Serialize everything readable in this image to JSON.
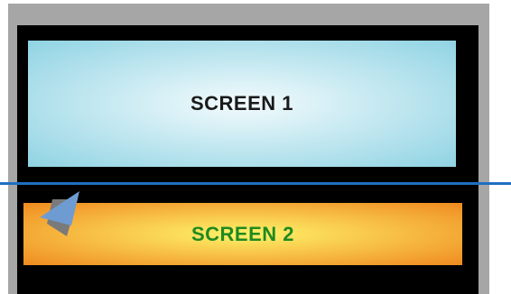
{
  "screens": {
    "screen_1_label": "SCREEN 1",
    "screen_2_label": "SCREEN 2"
  },
  "colors": {
    "frame": "#a6a6a6",
    "bezel": "#000000",
    "screen_1_center": "#f3fbfd",
    "screen_1_edge": "#8fd3e3",
    "screen_2_center": "#fff36a",
    "screen_2_edge": "#ef8a1f",
    "screen_2_text": "#1f8a1f",
    "divider_line": "#1f6fc2",
    "pointer_front": "#6f9bd3",
    "pointer_shadow": "#7a7a7a"
  }
}
